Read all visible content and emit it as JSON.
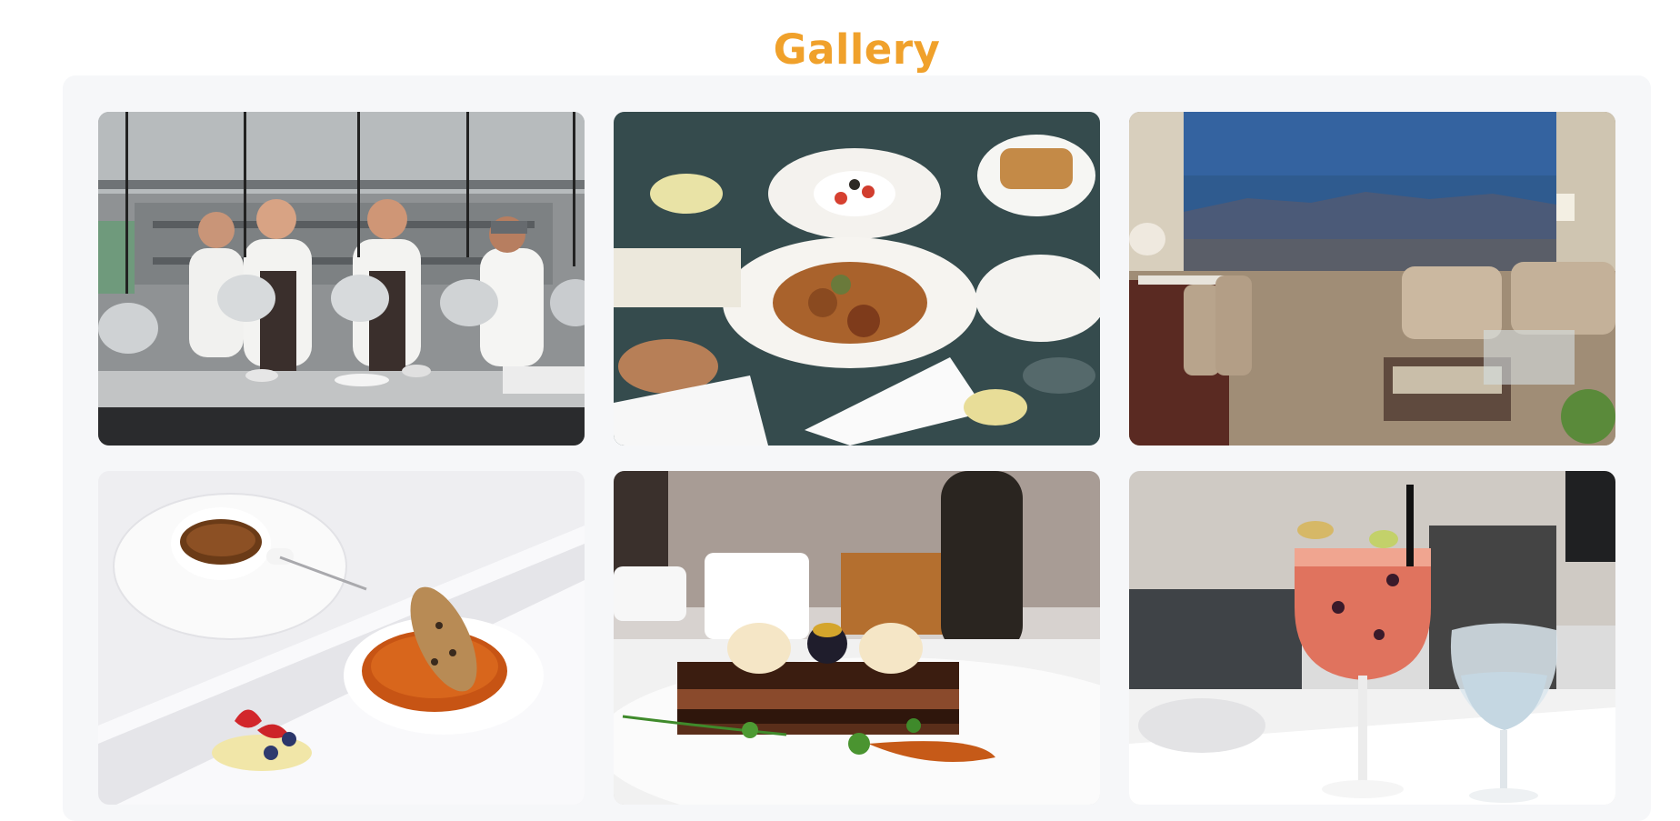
{
  "gallery": {
    "title": "Gallery",
    "title_color": "#f0a12b",
    "panel_color": "#f6f7f9",
    "images": [
      {
        "subject": "kitchen-chefs"
      },
      {
        "subject": "table-dishes"
      },
      {
        "subject": "lounge-view"
      },
      {
        "subject": "coffee-dessert"
      },
      {
        "subject": "chocolate-cake"
      },
      {
        "subject": "cocktail-glass"
      }
    ]
  }
}
